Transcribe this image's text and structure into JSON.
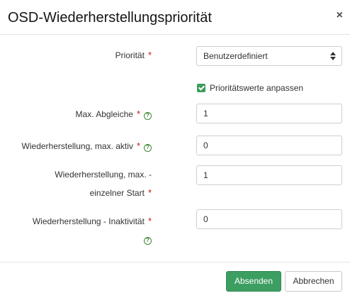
{
  "dialog": {
    "title": "OSD-Wiederherstellungspriorität",
    "close_icon": "×"
  },
  "form": {
    "required_marker": "*",
    "help_glyph": "?",
    "priority": {
      "label": "Priorität",
      "selected": "Benutzerdefiniert"
    },
    "customize": {
      "label": "Prioritätswerte anpassen",
      "checked": true
    },
    "max_backfills": {
      "label": "Max. Abgleiche",
      "value": "1"
    },
    "recovery_max_active": {
      "label": "Wiederherstellung, max. aktiv",
      "value": "0"
    },
    "recovery_max_single_start": {
      "label_line1": "Wiederherstellung, max. -",
      "label_line2": "einzelner Start",
      "value": "1"
    },
    "recovery_sleep": {
      "label": "Wiederherstellung - Inaktivität",
      "value": "0"
    }
  },
  "footer": {
    "submit_label": "Absenden",
    "cancel_label": "Abbrechen"
  },
  "colors": {
    "primary": "#3d9e62",
    "required": "#c9190b",
    "help": "#3e8635"
  },
  "icons": [
    "close-icon",
    "select-arrows-icon",
    "checkbox-check-icon",
    "help-icon"
  ]
}
